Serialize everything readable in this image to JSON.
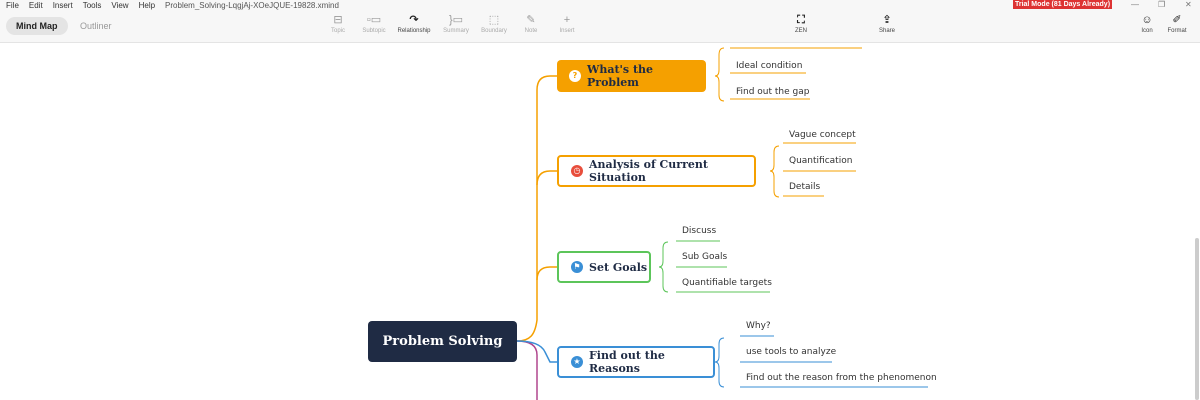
{
  "menu": {
    "items": [
      "File",
      "Edit",
      "Insert",
      "Tools",
      "View",
      "Help"
    ],
    "file_title": "Problem_Solving-LqgjAj-XOeJQUE-19828.xmind"
  },
  "trial_badge": "Trial Mode (81 Days Already)",
  "view_tabs": {
    "mind_map": "Mind Map",
    "outliner": "Outliner"
  },
  "toolbar": {
    "topic": "Topic",
    "subtopic": "Subtopic",
    "relationship": "Relationship",
    "summary": "Summary",
    "boundary": "Boundary",
    "note": "Note",
    "insert": "Insert",
    "zen": "ZEN",
    "share": "Share",
    "icon": "Icon",
    "format": "Format"
  },
  "mindmap": {
    "central": "Problem Solving",
    "branches": [
      {
        "title": "What's the Problem",
        "color": "#f5a000",
        "icon": "question-icon",
        "subtopics": [
          "Ideal condition",
          "Find out the gap"
        ]
      },
      {
        "title": "Analysis of Current Situation",
        "color": "#f5a000",
        "icon": "clock-icon",
        "subtopics": [
          "Vague concept",
          "Quantification",
          "Details"
        ]
      },
      {
        "title": "Set Goals",
        "color": "#5cc55a",
        "icon": "flag-icon",
        "subtopics": [
          "Discuss",
          "Sub Goals",
          "Quantifiable targets"
        ]
      },
      {
        "title": "Find out the Reasons",
        "color": "#3a8fd6",
        "icon": "star-icon",
        "subtopics": [
          "Why?",
          "use tools to analyze",
          "Find out the reason from the phenomenon"
        ]
      }
    ]
  }
}
